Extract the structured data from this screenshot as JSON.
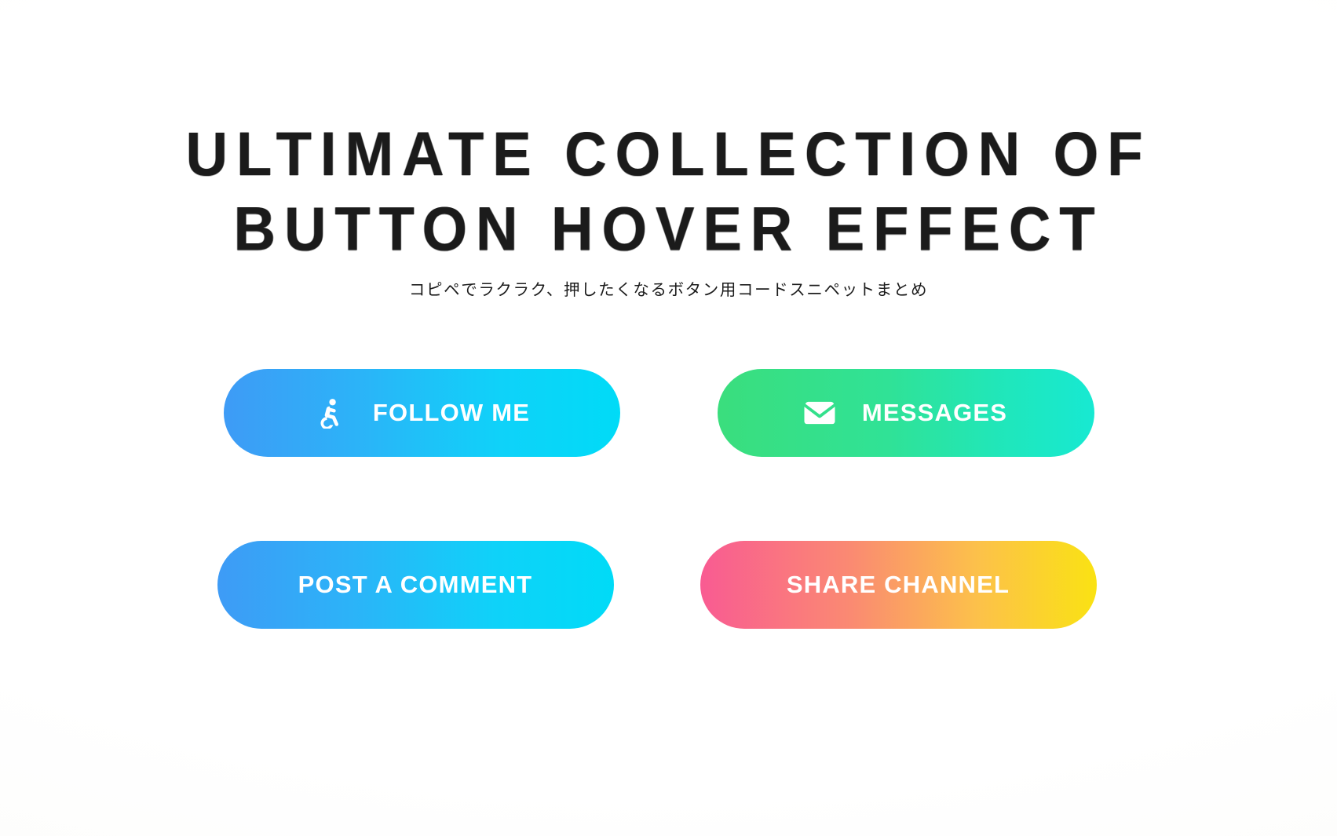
{
  "page": {
    "background_color": "#ffffff",
    "title_color": "#1b1b1b"
  },
  "header": {
    "title_line_1": "ULTIMATE COLLECTION OF",
    "title_line_2": "BUTTON HOVER EFFECT",
    "subtitle": "コピペでラクラク、押したくなるボタン用コードスニペットまとめ"
  },
  "buttons": [
    {
      "id": "follow-me",
      "label": "FOLLOW ME",
      "icon": "accessible-wheelchair-icon",
      "has_icon": true,
      "gradient_from": "#3e9bf6",
      "gradient_to": "#00dbf7",
      "text_color": "#ffffff"
    },
    {
      "id": "messages",
      "label": "MESSAGES",
      "icon": "envelope-icon",
      "has_icon": true,
      "gradient_from": "#3ade7d",
      "gradient_to": "#17e9d2",
      "text_color": "#ffffff"
    },
    {
      "id": "post-a-comment",
      "label": "POST A COMMENT",
      "icon": "",
      "has_icon": false,
      "gradient_from": "#3e9bf6",
      "gradient_to": "#00dbf7",
      "text_color": "#ffffff"
    },
    {
      "id": "share-channel",
      "label": "SHARE CHANNEL",
      "icon": "",
      "has_icon": false,
      "gradient_from": "#f95b92",
      "gradient_to": "#fae213",
      "text_color": "#ffffff"
    }
  ]
}
